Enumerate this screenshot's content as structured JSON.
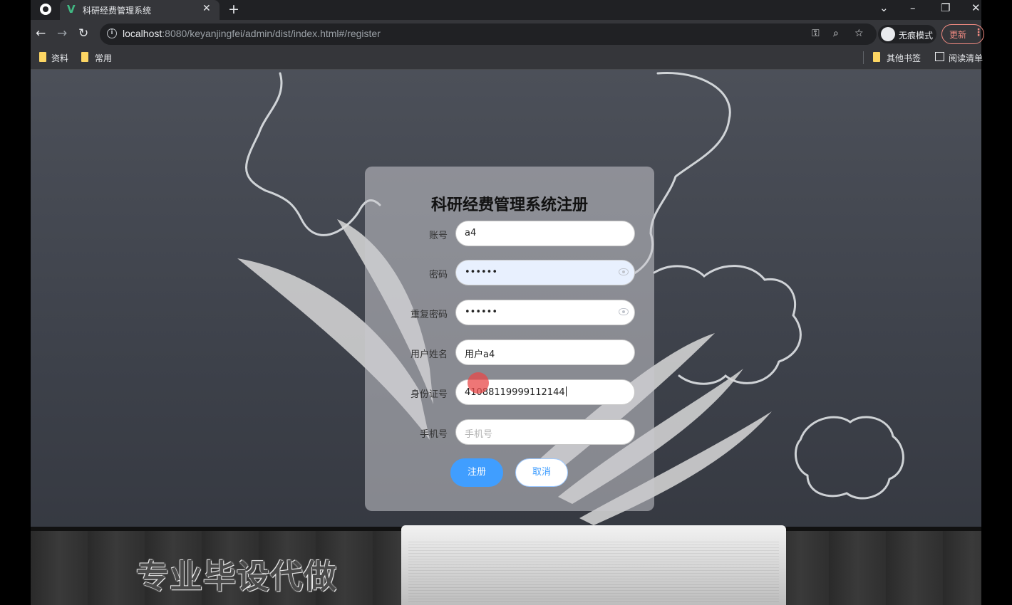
{
  "browser": {
    "tab_title": "科研经费管理系统",
    "tab_close": "✕",
    "new_tab": "+",
    "url_host": "localhost",
    "url_rest": ":8080/keyanjingfei/admin/dist/index.html#/register",
    "incognito_label": "无痕模式",
    "update_label": "更新",
    "bookmarks": [
      "资料",
      "常用"
    ],
    "other_bookmarks": "其他书签",
    "reading_list": "阅读清单"
  },
  "form": {
    "title": "科研经费管理系统注册",
    "fields": [
      {
        "label": "账号",
        "value": "a4",
        "placeholder": ""
      },
      {
        "label": "密码",
        "value": "••••••",
        "placeholder": ""
      },
      {
        "label": "重复密码",
        "value": "••••••",
        "placeholder": ""
      },
      {
        "label": "用户姓名",
        "value": "用户a4",
        "placeholder": ""
      },
      {
        "label": "身份证号",
        "value": "410881199991121​44",
        "placeholder": ""
      },
      {
        "label": "手机号",
        "value": "",
        "placeholder": "手机号"
      }
    ],
    "register_label": "注册",
    "cancel_label": "取消"
  },
  "watermark": "专业毕设代做",
  "colors": {
    "primary": "#409eff",
    "autofill": "#e8f0fe",
    "chrome_dark": "#202124",
    "chrome_toolbar": "#35363a"
  }
}
